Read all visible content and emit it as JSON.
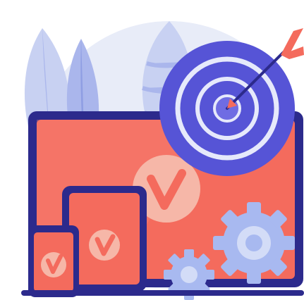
{
  "colors": {
    "background": "#ffffff",
    "backdrop_circle": "#e8ecf8",
    "leaf_light": "#c8d1f2",
    "leaf_mid": "#aab6ec",
    "leaf_dark": "#8f9ee3",
    "device_frame": "#2c2a8c",
    "device_screen": "#f46b5d",
    "device_screen_light": "#f7877a",
    "check_circle": "#f6b7a8",
    "check_mark": "#f46b5d",
    "target_outer": "#5654d6",
    "target_ring": "#e6e9fb",
    "target_inner": "#6f6ce3",
    "arrow_shaft": "#2c2a8c",
    "arrow_fletch": "#f46b5d",
    "gear": "#a8b9f0",
    "gear_hole": "#d3dcf7",
    "base_line": "#2c2a8c"
  },
  "icons": [
    "leaf-decoration",
    "laptop-screen",
    "tablet-device",
    "phone-device",
    "checkmark-icon",
    "target-icon",
    "arrow-icon",
    "gear-icon"
  ]
}
